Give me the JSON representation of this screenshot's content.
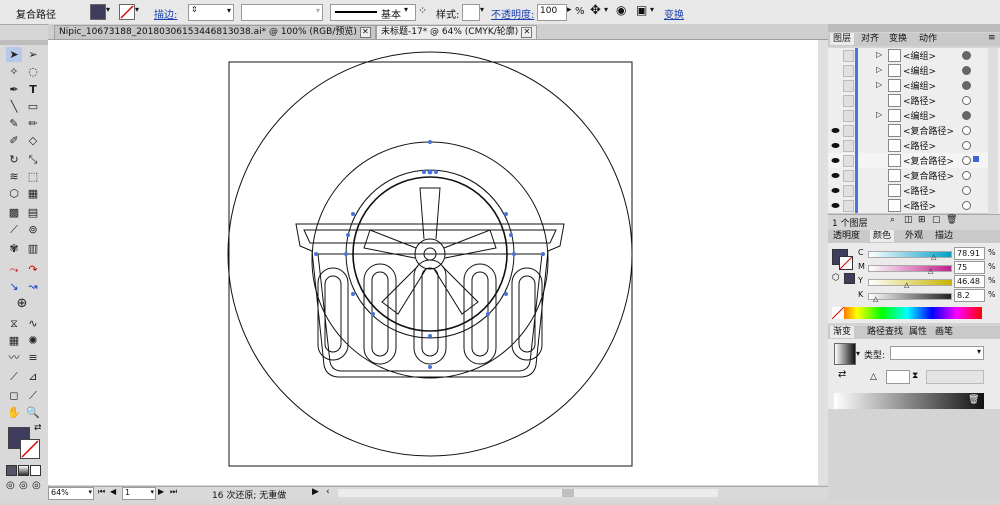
{
  "control_bar": {
    "selection_label": "复合路径",
    "stroke_link": "描边:",
    "stroke_style_value": "基本",
    "style_label": "样式:",
    "opacity_link": "不透明度:",
    "opacity_value": "100",
    "opacity_unit": "%",
    "transform_link": "变换",
    "fill_color": "#3f3d5e"
  },
  "documents": {
    "tabs": [
      {
        "label": "Nipic_10673188_20180306153446813038.ai* @ 100% (RGB/预览)"
      },
      {
        "label": "未标题-17* @ 64% (CMYK/轮廓)"
      }
    ]
  },
  "status_bar": {
    "zoom": "64%",
    "page": "1",
    "history_text": "16 次还原; 无重做"
  },
  "layers_panel": {
    "tabs": [
      "图层",
      "对齐",
      "变换",
      "动作"
    ],
    "rows": [
      {
        "name": "<编组>",
        "visible": false,
        "expandable": true,
        "filled": true
      },
      {
        "name": "<编组>",
        "visible": false,
        "expandable": true,
        "filled": true
      },
      {
        "name": "<编组>",
        "visible": false,
        "expandable": true,
        "filled": true
      },
      {
        "name": "<路径>",
        "visible": false,
        "expandable": false,
        "filled": false
      },
      {
        "name": "<编组>",
        "visible": false,
        "expandable": true,
        "filled": true
      },
      {
        "name": "<复合路径>",
        "visible": true,
        "expandable": false,
        "filled": false
      },
      {
        "name": "<路径>",
        "visible": true,
        "expandable": false,
        "filled": false
      },
      {
        "name": "<复合路径>",
        "visible": true,
        "expandable": false,
        "filled": false,
        "selected": true
      },
      {
        "name": "<复合路径>",
        "visible": true,
        "expandable": false,
        "filled": false
      },
      {
        "name": "<路径>",
        "visible": true,
        "expandable": false,
        "filled": false
      },
      {
        "name": "<路径>",
        "visible": true,
        "expandable": false,
        "filled": false
      }
    ],
    "footer_count": "1 个图层"
  },
  "color_panel": {
    "tabs": [
      "透明度",
      "颜色",
      "外观",
      "描边"
    ],
    "channels": [
      {
        "label": "C",
        "value": "78.91",
        "level": 0.7891,
        "color": "#00a0c8"
      },
      {
        "label": "M",
        "value": "75",
        "level": 0.75,
        "color": "#c0208a"
      },
      {
        "label": "Y",
        "value": "46.48",
        "level": 0.4648,
        "color": "#c8b400"
      },
      {
        "label": "K",
        "value": "8.2",
        "level": 0.082,
        "color": "#222222"
      }
    ],
    "unit": "%"
  },
  "gradient_panel": {
    "tabs": [
      "渐变",
      "路径查找",
      "属性",
      "画笔"
    ],
    "type_label": "类型:"
  }
}
